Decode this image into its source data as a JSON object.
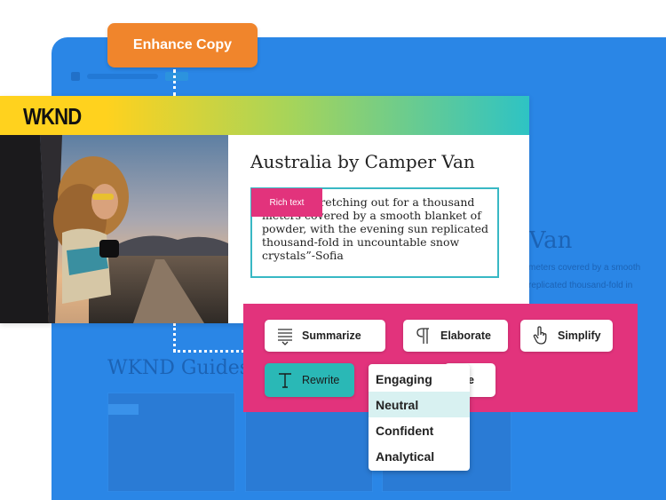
{
  "enhance_button": {
    "label": "Enhance Copy"
  },
  "brand": {
    "logo": "WKND"
  },
  "article": {
    "title": "Australia by Camper Van",
    "body": "“In face stretching out for a thousand meters covered by a smooth blanket of powder, with the evening sun replicated thousand-fold in uncountable snow crystals”-Sofia",
    "rich_text_badge": "Rich text"
  },
  "background": {
    "heading": "r Van",
    "text": "meters covered by a smooth replicated thousand-fold in",
    "guides_heading": "WKND Guides"
  },
  "actions": {
    "summarize": "Summarize",
    "elaborate": "Elaborate",
    "simplify": "Simplify",
    "rewrite": "Rewrite",
    "hidden_tail": "e"
  },
  "tone_menu": {
    "options": [
      "Engaging",
      "Neutral",
      "Confident",
      "Analytical"
    ],
    "highlighted": "Neutral"
  },
  "colors": {
    "window_blue": "#2a86e6",
    "enhance_orange": "#f0852c",
    "panel_pink": "#e2337c",
    "rewrite_teal": "#2ab8b6",
    "rich_border": "#38b8c4"
  },
  "icons": {
    "summarize": "summarize-lines-icon",
    "elaborate": "pilcrow-icon",
    "simplify": "hand-pointer-icon",
    "rewrite": "text-t-icon"
  }
}
